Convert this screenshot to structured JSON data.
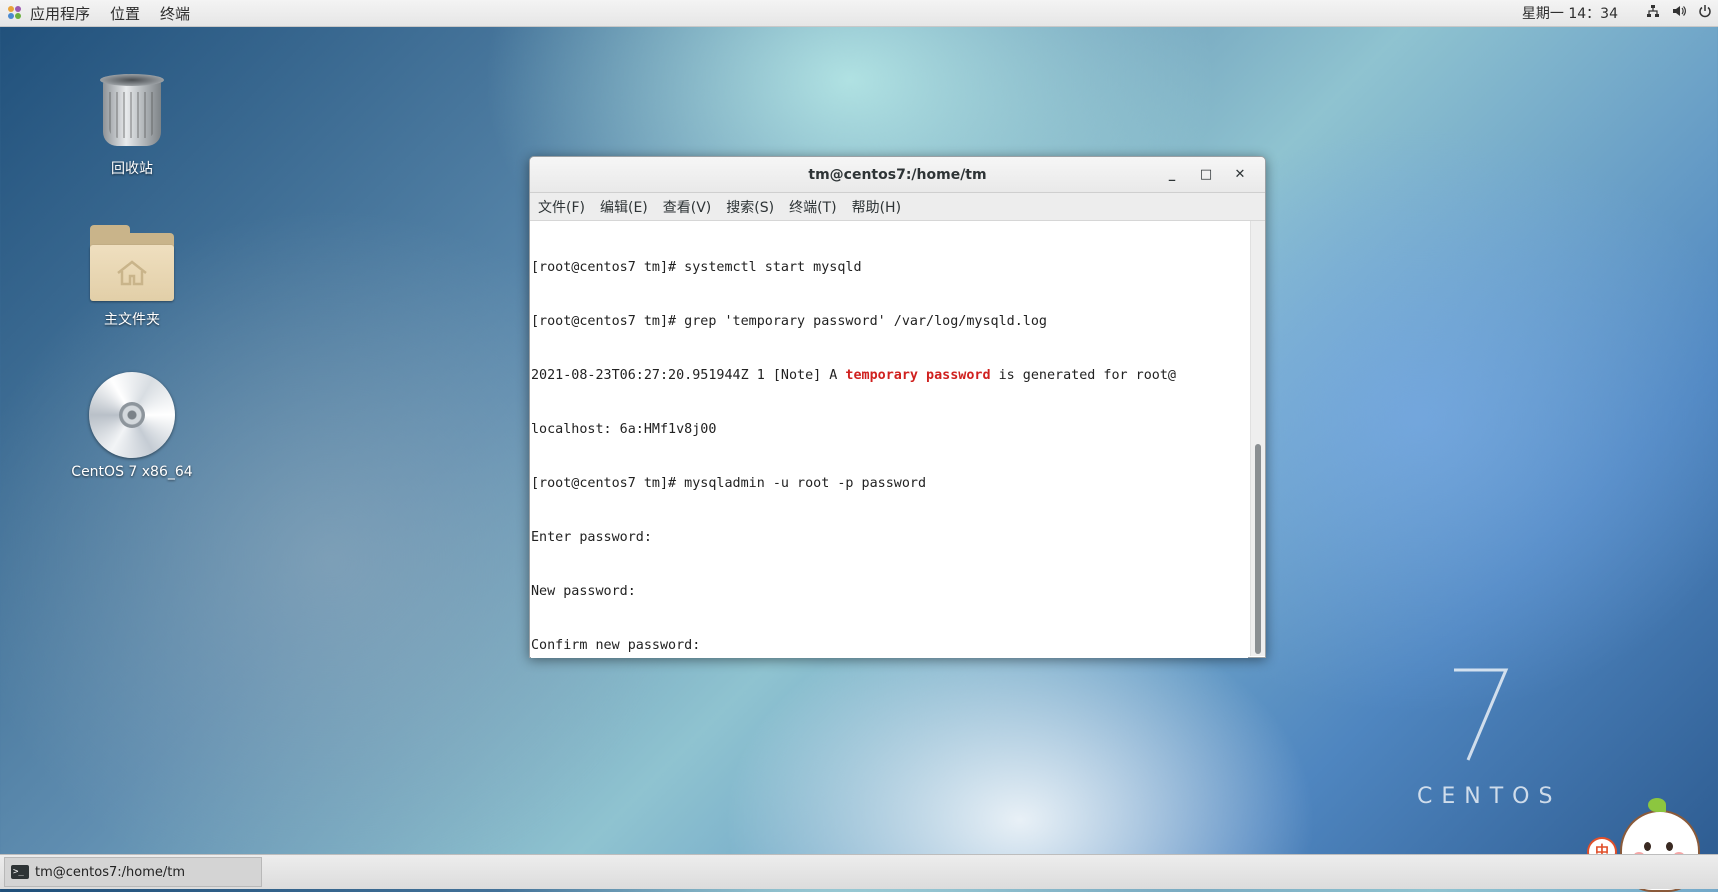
{
  "top_panel": {
    "applications": "应用程序",
    "places": "位置",
    "terminal": "终端",
    "clock": "星期一 14：34",
    "icons": [
      "network-icon",
      "volume-icon",
      "power-icon"
    ]
  },
  "desktop": {
    "icons": [
      {
        "label": "回收站",
        "icon": "trash-icon"
      },
      {
        "label": "主文件夹",
        "icon": "home-folder-icon"
      },
      {
        "label": "CentOS 7 x86_64",
        "icon": "disc-icon"
      }
    ]
  },
  "window": {
    "title": "tm@centos7:/home/tm",
    "controls": {
      "minimize": "_",
      "maximize": "□",
      "close": "✕"
    },
    "menu": [
      "文件(F)",
      "编辑(E)",
      "查看(V)",
      "搜索(S)",
      "终端(T)",
      "帮助(H)"
    ],
    "terminal": {
      "line1": "[root@centos7 tm]# systemctl start mysqld",
      "line2": "[root@centos7 tm]# grep 'temporary password' /var/log/mysqld.log",
      "line3_prefix": "2021-08-23T06:27:20.951944Z 1 [Note] A ",
      "line3_highlight": "temporary password",
      "line3_suffix": " is generated for root@",
      "line4": "localhost: 6a:HMf1v8j00",
      "line5": "[root@centos7 tm]# mysqladmin -u root -p password",
      "line6": "Enter password:",
      "line7": "New password:",
      "line8": "Confirm new password:"
    }
  },
  "watermark": {
    "number": "7",
    "text": "CENTOS"
  },
  "taskbar": {
    "item_label": "tm@centos7:/home/tm"
  },
  "ime": {
    "mode": "中"
  },
  "colors": {
    "highlight": "#d0211f",
    "ime_accent": "#e0502b"
  }
}
